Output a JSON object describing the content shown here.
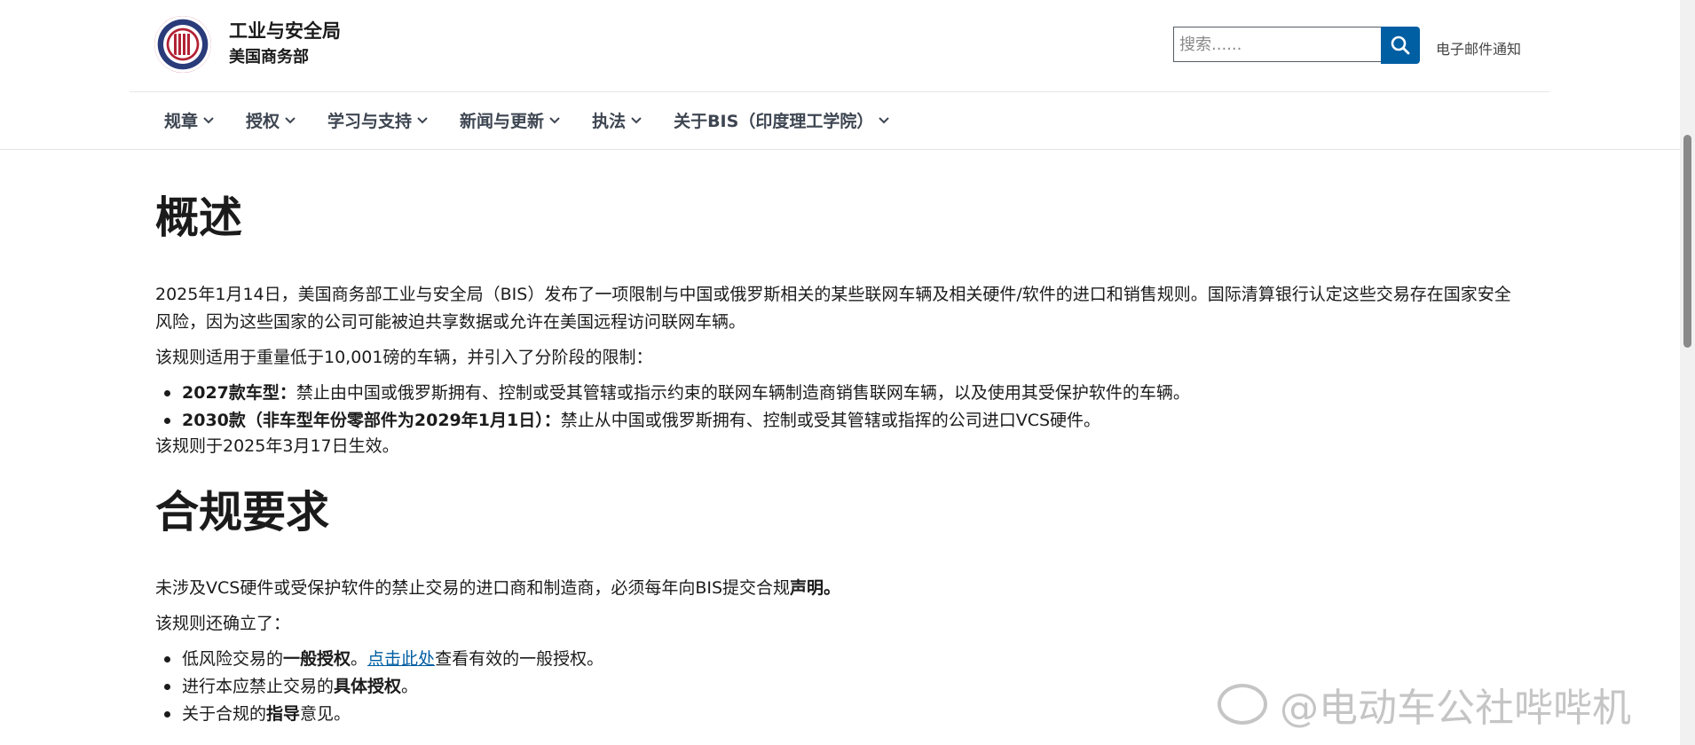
{
  "header": {
    "agency_name": "工业与安全局",
    "department": "美国商务部",
    "search_placeholder": "搜索......",
    "email_link": "电子邮件通知"
  },
  "nav": [
    "规章",
    "授权",
    "学习与支持",
    "新闻与更新",
    "执法",
    "关于BIS（印度理工学院）"
  ],
  "overview": {
    "heading": "概述",
    "para1": "2025年1月14日，美国商务部工业与安全局（BIS）发布了一项限制与中国或俄罗斯相关的某些联网车辆及相关硬件/软件的进口和销售规则。国际清算银行认定这些交易存在国家安全风险，因为这些国家的公司可能被迫共享数据或允许在美国远程访问联网车辆。",
    "para2": "该规则适用于重量低于10,001磅的车辆，并引入了分阶段的限制：",
    "bullets": [
      {
        "bold": "2027款车型：",
        "text": "禁止由中国或俄罗斯拥有、控制或受其管辖或指示约束的联网车辆制造商销售联网车辆，以及使用其受保护软件的车辆。"
      },
      {
        "bold": "2030款（非车型年份零部件为2029年1月1日）：",
        "text": "禁止从中国或俄罗斯拥有、控制或受其管辖或指挥的公司进口VCS硬件。"
      }
    ],
    "effective": "该规则于2025年3月17日生效。"
  },
  "compliance": {
    "heading": "合规要求",
    "para1_text": "未涉及VCS硬件或受保护软件的禁止交易的进口商和制造商，必须每年向BIS提交合规",
    "para1_bold": "声明。",
    "para2": "该规则还确立了：",
    "bullets": [
      {
        "pre": "低风险交易的",
        "bold": "一般授权",
        "mid": "。",
        "link": "点击此处",
        "post": "查看有效的一般授权。"
      },
      {
        "pre": "进行本应禁止交易的",
        "bold": "具体授权",
        "post": "。"
      },
      {
        "pre": "关于合规的",
        "bold": "指导",
        "post": "意见。"
      }
    ]
  },
  "watermark": "@电动车公社哔哔机",
  "icons": {
    "logo": "bis-seal-icon",
    "search": "search-icon",
    "chevron": "chevron-down-icon"
  },
  "colors": {
    "accent": "#005ea2",
    "nav_text": "#3d4551"
  }
}
